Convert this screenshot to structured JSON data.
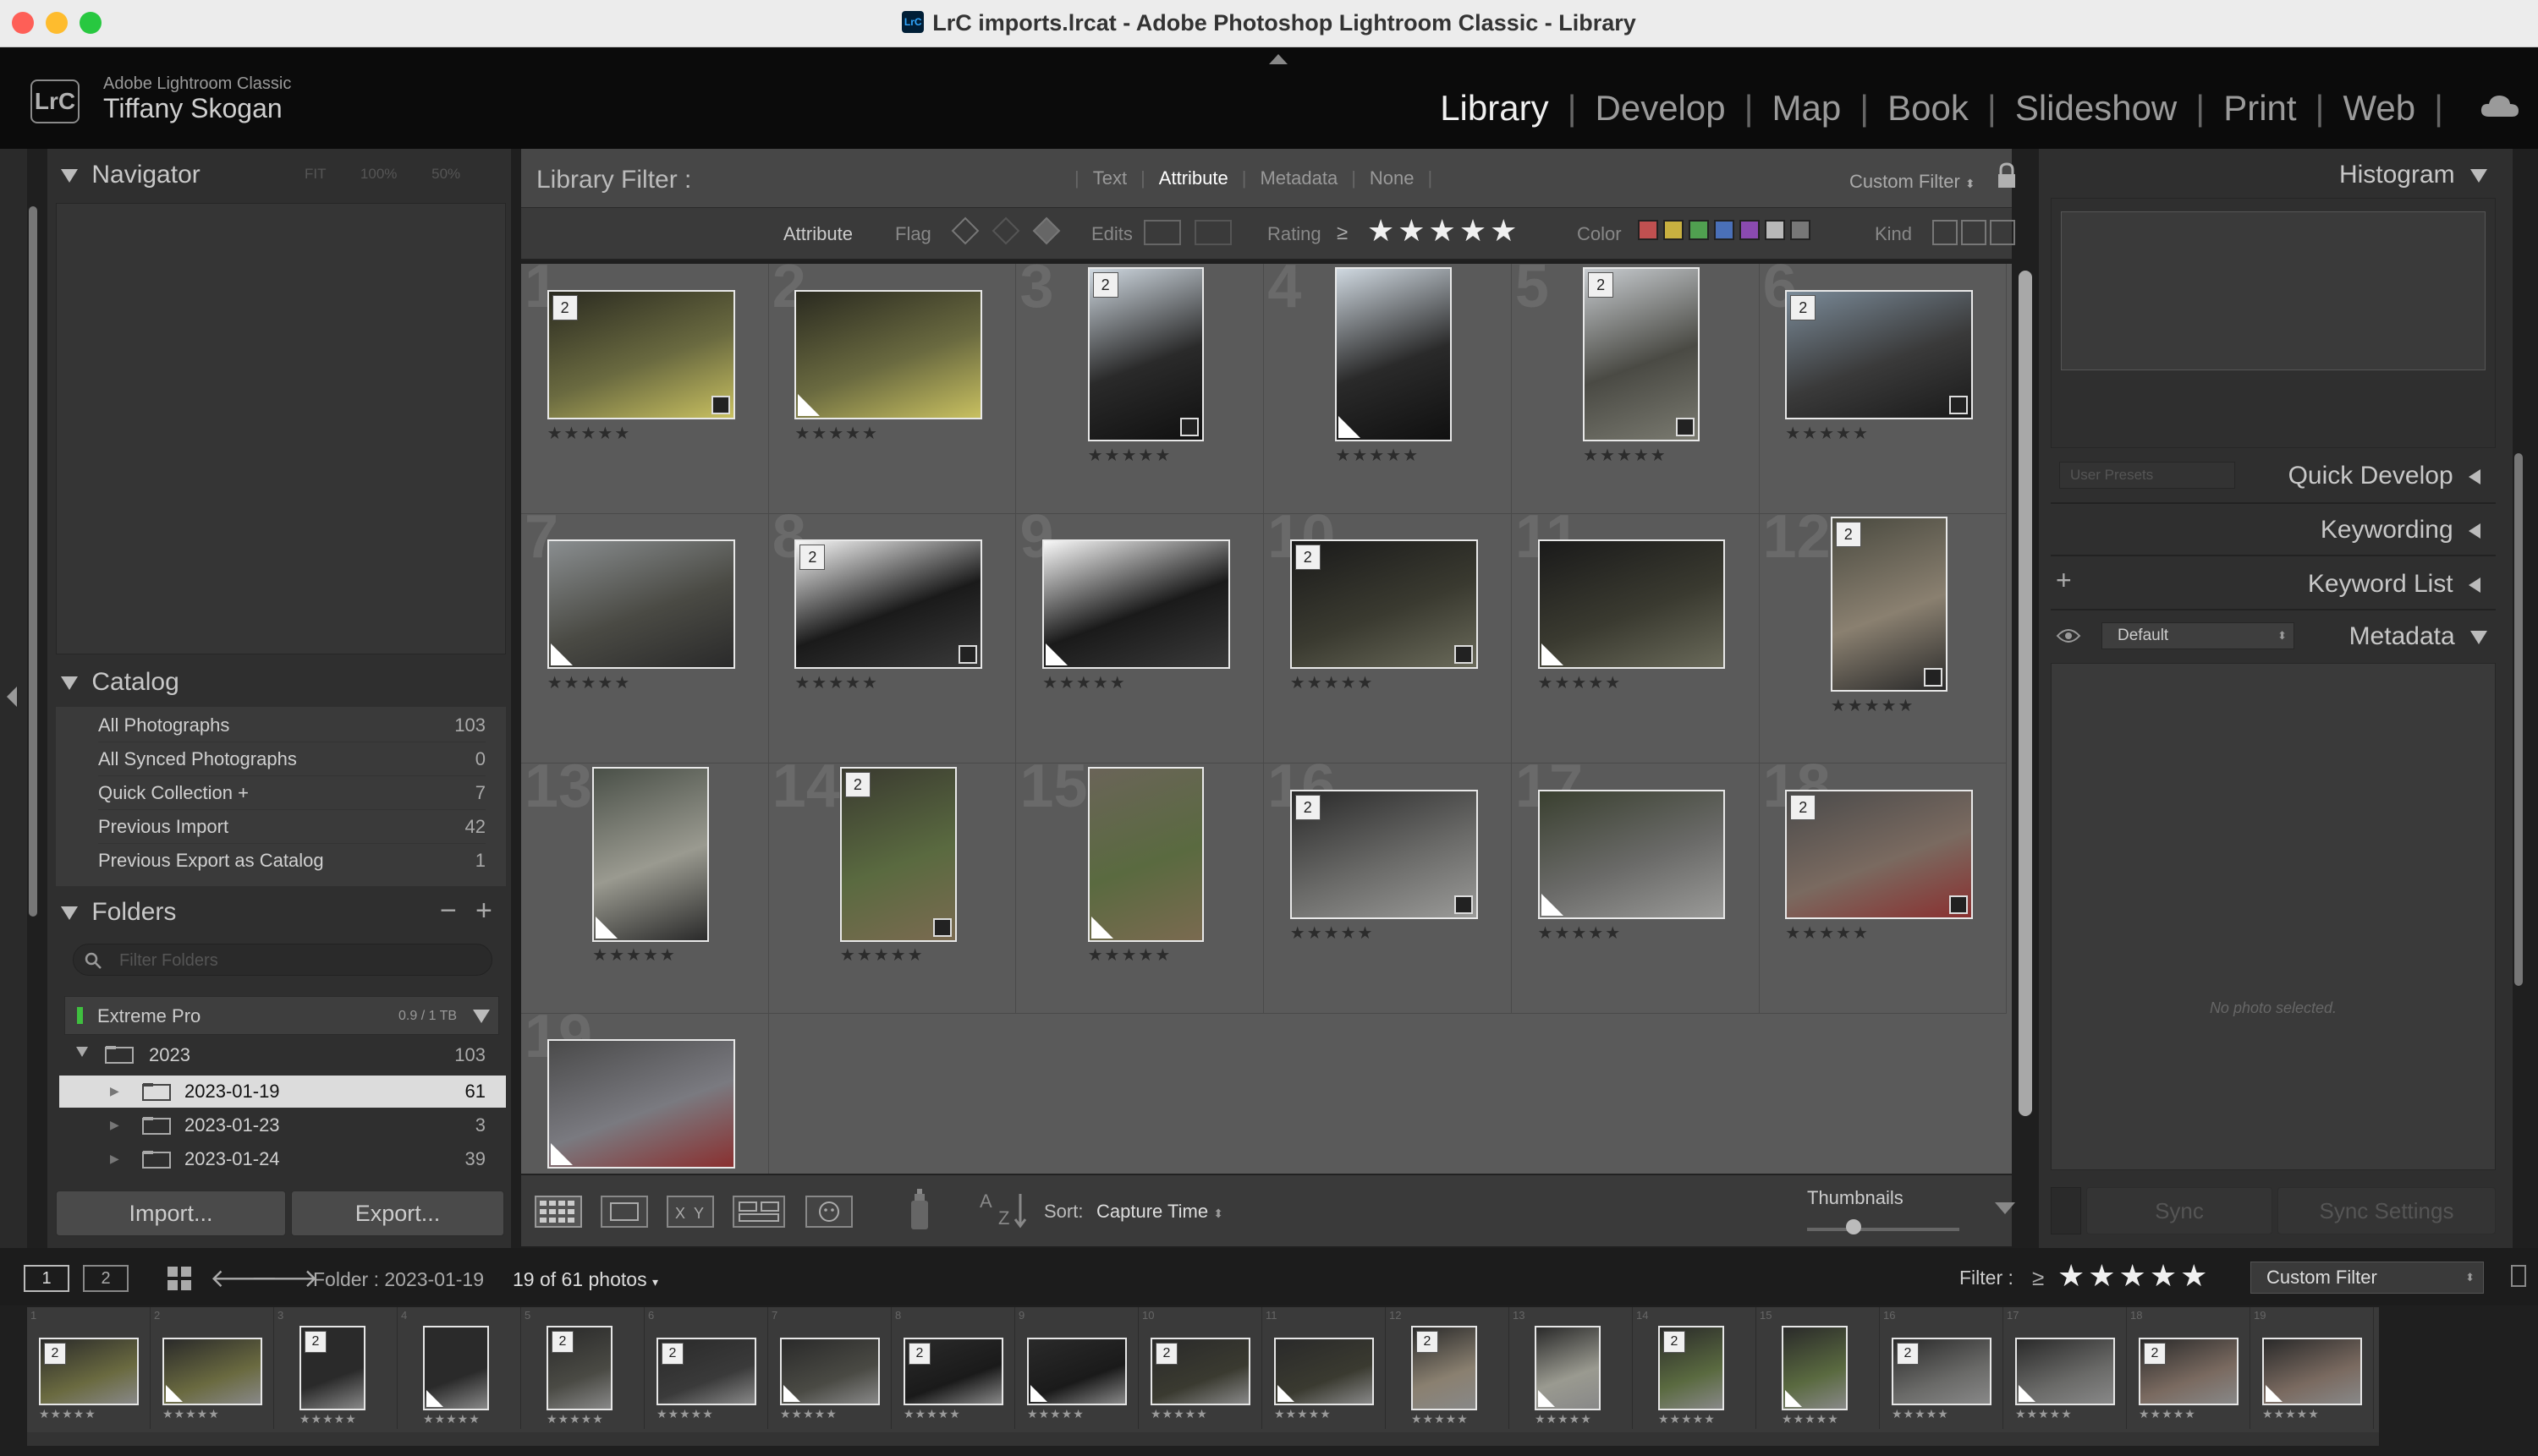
{
  "window": {
    "title": "LrC imports.lrcat - Adobe Photoshop Lightroom Classic - Library",
    "app_icon": "LrC"
  },
  "identity": {
    "logo": "LrC",
    "product": "Adobe Lightroom Classic",
    "user": "Tiffany Skogan"
  },
  "modules": [
    "Library",
    "Develop",
    "Map",
    "Book",
    "Slideshow",
    "Print",
    "Web"
  ],
  "active_module": "Library",
  "left": {
    "navigator": {
      "title": "Navigator",
      "zoom_options": [
        "FIT",
        "100%",
        "50%"
      ]
    },
    "catalog": {
      "title": "Catalog",
      "items": [
        {
          "label": "All Photographs",
          "count": "103"
        },
        {
          "label": "All Synced Photographs",
          "count": "0"
        },
        {
          "label": "Quick Collection +",
          "count": "7"
        },
        {
          "label": "Previous Import",
          "count": "42"
        },
        {
          "label": "Previous Export as Catalog",
          "count": "1"
        }
      ]
    },
    "folders": {
      "title": "Folders",
      "minus": "−",
      "plus": "+",
      "filter_placeholder": "Filter Folders",
      "volume": {
        "name": "Extreme Pro",
        "usage": "0.9 / 1 TB"
      },
      "tree": [
        {
          "label": "2023",
          "count": "103"
        },
        {
          "label": "2023-01-19",
          "count": "61"
        },
        {
          "label": "2023-01-23",
          "count": "3"
        },
        {
          "label": "2023-01-24",
          "count": "39"
        }
      ]
    },
    "import_label": "Import...",
    "export_label": "Export..."
  },
  "filter_bar": {
    "title": "Library Filter :",
    "tabs": [
      "Text",
      "Attribute",
      "Metadata",
      "None"
    ],
    "active_tab": "Attribute",
    "preset": "Custom Filter",
    "attribute_label": "Attribute",
    "flag_label": "Flag",
    "edits_label": "Edits",
    "rating_label": "Rating",
    "rating_op": "≥",
    "color_label": "Color",
    "kind_label": "Kind",
    "colors": [
      "#c05050",
      "#c8b040",
      "#50a050",
      "#4a70b8",
      "#8a4ab0",
      "#b8b8b8",
      "#777777"
    ]
  },
  "grid": {
    "stars": "★★★★★",
    "cells": [
      {
        "n": "1",
        "badge": "2"
      },
      {
        "n": "2",
        "badge": ""
      },
      {
        "n": "3",
        "badge": "2"
      },
      {
        "n": "4",
        "badge": ""
      },
      {
        "n": "5",
        "badge": "2"
      },
      {
        "n": "6",
        "badge": "2"
      },
      {
        "n": "7",
        "badge": ""
      },
      {
        "n": "8",
        "badge": "2"
      },
      {
        "n": "9",
        "badge": ""
      },
      {
        "n": "10",
        "badge": "2"
      },
      {
        "n": "11",
        "badge": ""
      },
      {
        "n": "12",
        "badge": "2"
      },
      {
        "n": "13",
        "badge": ""
      },
      {
        "n": "14",
        "badge": "2"
      },
      {
        "n": "15",
        "badge": ""
      },
      {
        "n": "16",
        "badge": "2"
      },
      {
        "n": "17",
        "badge": ""
      },
      {
        "n": "18",
        "badge": "2"
      },
      {
        "n": "19",
        "badge": ""
      }
    ]
  },
  "toolbar": {
    "sort_label": "Sort:",
    "sort_value": "Capture Time",
    "thumbnails_label": "Thumbnails"
  },
  "right": {
    "histogram": "Histogram",
    "quick_develop": "Quick Develop",
    "user_presets": "User Presets",
    "keywording": "Keywording",
    "keyword_list": "Keyword List",
    "metadata": "Metadata",
    "metadata_preset": "Default",
    "no_photo": "No photo selected.",
    "sync": "Sync",
    "sync_settings": "Sync Settings"
  },
  "filmstrip_bar": {
    "screen1": "1",
    "screen2": "2",
    "folder": "Folder : 2023-01-19",
    "count": "19 of 61 photos",
    "filter_label": "Filter :",
    "filter_op": "≥",
    "stars": "★★★★★",
    "filter_preset": "Custom Filter"
  },
  "filmstrip": {
    "stars": "★★★★★"
  }
}
